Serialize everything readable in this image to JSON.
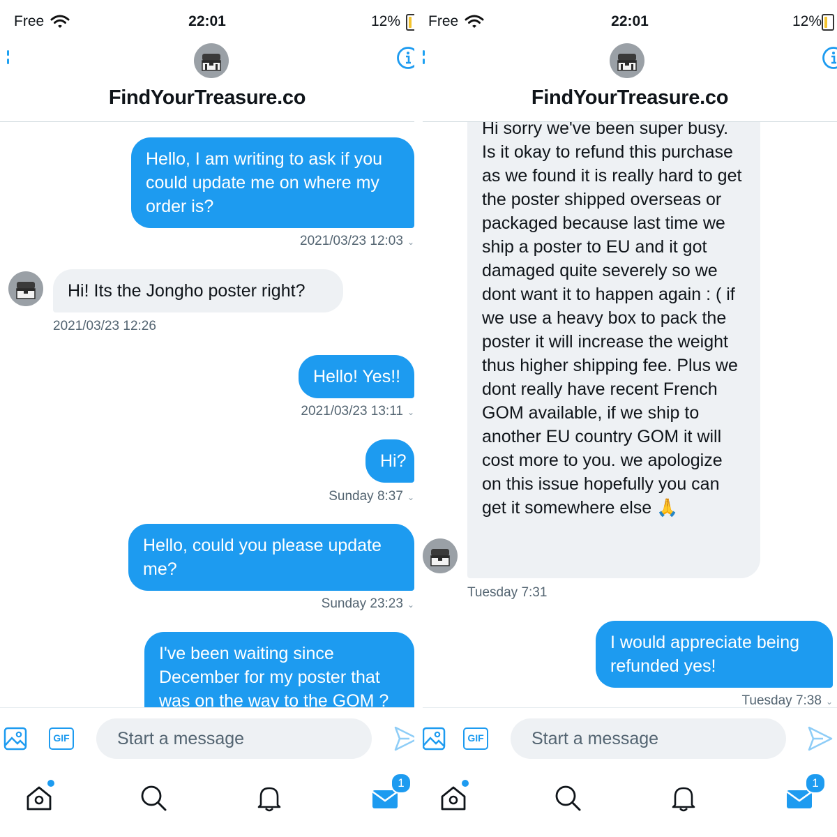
{
  "left": {
    "status": {
      "carrier": "Free",
      "time": "22:01",
      "battery": "12%"
    },
    "header": {
      "name": "FindYourTreasure.co"
    },
    "messages": [
      {
        "text": "Hello, I am writing to ask if you could update me on where my order is?",
        "time": "2021/03/23 12:03"
      },
      {
        "text": "Hi! Its the Jongho poster right?",
        "time": "2021/03/23 12:26"
      },
      {
        "text": "Hello! Yes!!",
        "time": "2021/03/23 13:11"
      },
      {
        "text": "Hi?",
        "time": "Sunday 8:37"
      },
      {
        "text": "Hello, could you please update me?",
        "time": "Sunday 23:23"
      },
      {
        "text": "I've been waiting since December for my poster that was on the way to the GOM ?"
      }
    ],
    "composer": {
      "gif_label": "GIF",
      "placeholder": "Start a message"
    },
    "tabs": {
      "messages_badge": "1"
    }
  },
  "right": {
    "status": {
      "carrier": "Free",
      "time": "22:01",
      "battery": "12%"
    },
    "header": {
      "name": "FindYourTreasure.co"
    },
    "messages": [
      {
        "text": "Hi sorry we've been super busy. Is it okay to refund this purchase as we found it is really hard to get the poster shipped overseas or packaged because last time we ship a poster to EU and it got damaged quite severely so we dont want it to happen again : ( if we use a heavy box to pack the poster it will increase the weight thus higher shipping fee.  Plus we dont really have recent French GOM available, if we ship to another EU country GOM it will cost more to you. we apologize on this issue hopefully you can get it somewhere else 🙏",
        "time": "Tuesday 7:31"
      },
      {
        "text": "I would appreciate being refunded yes!",
        "time": "Tuesday 7:38"
      }
    ],
    "composer": {
      "gif_label": "GIF",
      "placeholder": "Start a message"
    },
    "tabs": {
      "messages_badge": "1"
    }
  },
  "colors": {
    "accent": "#1d9bf0",
    "incoming_bubble": "#eef1f4",
    "meta_text": "#536471",
    "battery": "#f4c430"
  },
  "icons": [
    "wifi-icon",
    "back-chevron-icon",
    "info-icon",
    "image-icon",
    "gif-icon",
    "send-icon",
    "home-icon",
    "search-icon",
    "bell-icon",
    "mail-icon",
    "avatar-treasure-chest"
  ]
}
